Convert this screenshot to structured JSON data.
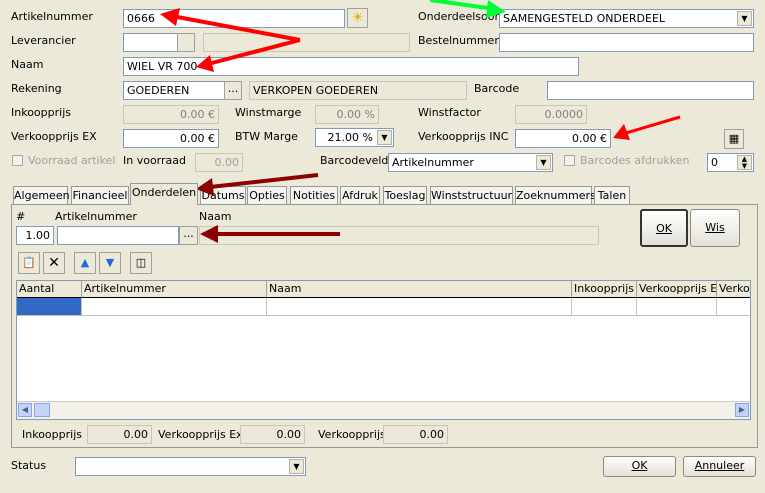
{
  "form": {
    "artikelnummer_label": "Artikelnummer",
    "artikelnummer_value": "0666",
    "leverancier_label": "Leverancier",
    "naam_label": "Naam",
    "naam_value": "WIEL VR 700",
    "rekening_label": "Rekening",
    "rekening_value": "GOEDEREN",
    "rekening_desc": "VERKOPEN GOEDEREN",
    "inkoopprijs_label": "Inkoopprijs",
    "inkoopprijs_value": "0.00 €",
    "verkoopprijs_ex_label": "Verkoopprijs EX",
    "verkoopprijs_ex_value": "0.00 €",
    "voorraad_label": "Voorraad artikel",
    "in_voorraad_label": "In voorraad",
    "in_voorraad_value": "0.00",
    "onderdeelsoort_label": "Onderdeelsoort",
    "onderdeelsoort_value": "SAMENGESTELD ONDERDEEL",
    "bestelnummer_label": "Bestelnummer",
    "barcode_label": "Barcode",
    "winstmarge_label": "Winstmarge",
    "winstmarge_value": "0.00 %",
    "winstfactor_label": "Winstfactor",
    "winstfactor_value": "0.0000",
    "btw_marge_label": "BTW Marge",
    "btw_marge_value": "21.00 %",
    "verkoopprijs_inc_label": "Verkoopprijs INC",
    "verkoopprijs_inc_value": "0.00 €",
    "barcodeveld_label": "Barcodeveld",
    "barcodeveld_value": "Artikelnummer",
    "barcodes_afdrukken_label": "Barcodes afdrukken",
    "barcodes_count": "0",
    "ellipsis": "..."
  },
  "tabs": [
    {
      "label": "Algemeen"
    },
    {
      "label": "Financieel"
    },
    {
      "label": "Onderdelen"
    },
    {
      "label": "Datums"
    },
    {
      "label": "Opties"
    },
    {
      "label": "Notities"
    },
    {
      "label": "Afdruk"
    },
    {
      "label": "Toeslag"
    },
    {
      "label": "Winststructuur"
    },
    {
      "label": "Zoeknummers"
    },
    {
      "label": "Talen"
    }
  ],
  "onderdelen": {
    "hash_label": "#",
    "artikelnummer_label": "Artikelnummer",
    "naam_label": "Naam",
    "qty_value": "1.00",
    "ok_label": "OK",
    "wis_label": "Wis",
    "columns": [
      "Aantal",
      "Artikelnummer",
      "Naam",
      "Inkoopprijs",
      "Verkoopprijs EX",
      "Verkoo"
    ],
    "totals": {
      "inkoopprijs_label": "Inkoopprijs",
      "inkoopprijs_value": "0.00",
      "verkoopprijs_ex_label": "Verkoopprijs Ex",
      "verkoopprijs_ex_value": "0.00",
      "verkoopprijs_label": "Verkoopprijs",
      "verkoopprijs_value": "0.00"
    }
  },
  "footer": {
    "status_label": "Status",
    "ok_label": "OK",
    "annuleer_label": "Annuleer"
  },
  "colors": {
    "background": "#ece9d8",
    "red_arrow": "#ff0000",
    "darkred_arrow": "#8b0000",
    "green_arrow": "#00ff33",
    "selection": "#316ac5"
  }
}
